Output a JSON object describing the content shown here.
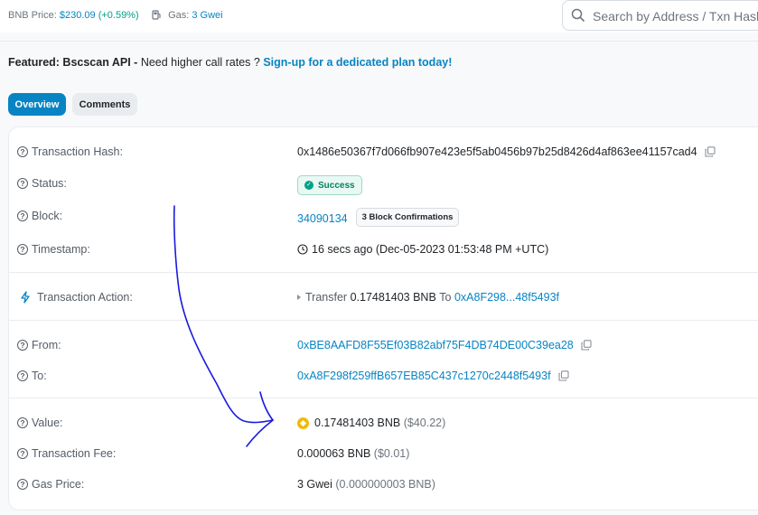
{
  "header": {
    "price_label": "BNB Price:",
    "price_value": "$230.09",
    "price_change": "(+0.59%)",
    "gas_label": "Gas:",
    "gas_value": "3 Gwei",
    "search_placeholder": "Search by Address / Txn Hash"
  },
  "featured": {
    "prefix": "Featured: Bscscan API -",
    "text": "Need higher call rates ?",
    "link": "Sign-up for a dedicated plan today!"
  },
  "tabs": [
    {
      "label": "Overview",
      "active": true
    },
    {
      "label": "Comments",
      "active": false
    }
  ],
  "details": {
    "tx_hash": {
      "label": "Transaction Hash:",
      "value": "0x1486e50367f7d066fb907e423e5f5ab0456b97b25d8426d4af863ee41157cad4"
    },
    "status": {
      "label": "Status:",
      "value": "Success"
    },
    "block": {
      "label": "Block:",
      "value": "34090134",
      "confirmations": "3 Block Confirmations"
    },
    "timestamp": {
      "label": "Timestamp:",
      "value": "16 secs ago (Dec-05-2023 01:53:48 PM +UTC)"
    },
    "action": {
      "label": "Transaction Action:",
      "verb": "Transfer",
      "amount": "0.17481403 BNB",
      "to_word": "To",
      "to_addr": "0xA8F298...48f5493f"
    },
    "from": {
      "label": "From:",
      "value": "0xBE8AAFD8F55Ef03B82abf75F4DB74DE00C39ea28"
    },
    "to": {
      "label": "To:",
      "value": "0xA8F298f259ffB657EB85C437c1270c2448f5493f"
    },
    "value": {
      "label": "Value:",
      "amount": "0.17481403 BNB",
      "usd": "($40.22)"
    },
    "fee": {
      "label": "Transaction Fee:",
      "amount": "0.000063 BNB",
      "usd": "($0.01)"
    },
    "gas_price": {
      "label": "Gas Price:",
      "amount": "3 Gwei",
      "bnb": "(0.000000003 BNB)"
    }
  },
  "colors": {
    "link": "#0784c3",
    "success": "#00a186",
    "annotation": "#1a1ae0"
  }
}
